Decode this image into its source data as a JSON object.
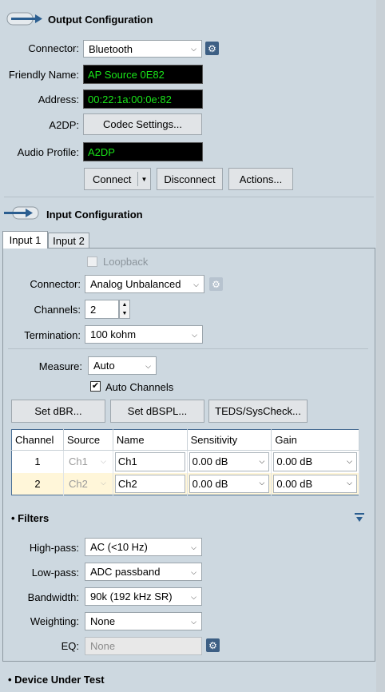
{
  "output": {
    "title": "Output Configuration",
    "connector_label": "Connector:",
    "connector_value": "Bluetooth",
    "friendly_label": "Friendly Name:",
    "friendly_value": "AP Source 0E82",
    "address_label": "Address:",
    "address_value": "00:22:1a:00:0e:82",
    "a2dp_label": "A2DP:",
    "codec_button": "Codec Settings...",
    "profile_label": "Audio Profile:",
    "profile_value": "A2DP",
    "connect_button": "Connect",
    "disconnect_button": "Disconnect",
    "actions_button": "Actions..."
  },
  "input": {
    "title": "Input Configuration",
    "tabs": [
      "Input 1",
      "Input 2"
    ],
    "loopback_label": "Loopback",
    "connector_label": "Connector:",
    "connector_value": "Analog Unbalanced",
    "channels_label": "Channels:",
    "channels_value": "2",
    "termination_label": "Termination:",
    "termination_value": "100 kohm",
    "measure_label": "Measure:",
    "measure_value": "Auto",
    "auto_channels_label": "Auto Channels",
    "auto_channels_checked": true,
    "set_dbr_button": "Set dBR...",
    "set_dbspl_button": "Set dBSPL...",
    "teds_button": "TEDS/SysCheck...",
    "table": {
      "headers": [
        "Channel",
        "Source",
        "Name",
        "Sensitivity",
        "Gain"
      ],
      "rows": [
        {
          "channel": "1",
          "source": "Ch1",
          "name": "Ch1",
          "sensitivity": "0.00 dB",
          "gain": "0.00 dB"
        },
        {
          "channel": "2",
          "source": "Ch2",
          "name": "Ch2",
          "sensitivity": "0.00 dB",
          "gain": "0.00 dB"
        }
      ]
    }
  },
  "filters": {
    "title": "Filters",
    "highpass_label": "High-pass:",
    "highpass_value": "AC (<10 Hz)",
    "lowpass_label": "Low-pass:",
    "lowpass_value": "ADC passband",
    "bandwidth_label": "Bandwidth:",
    "bandwidth_value": "90k (192 kHz SR)",
    "weighting_label": "Weighting:",
    "weighting_value": "None",
    "eq_label": "EQ:",
    "eq_value": "None"
  },
  "dut": {
    "title": "Device Under Test"
  },
  "colors": {
    "background": "#cdd8e0",
    "accent": "#3d5f84",
    "terminal_text": "#19e519",
    "selected_row": "#fff6d9"
  }
}
